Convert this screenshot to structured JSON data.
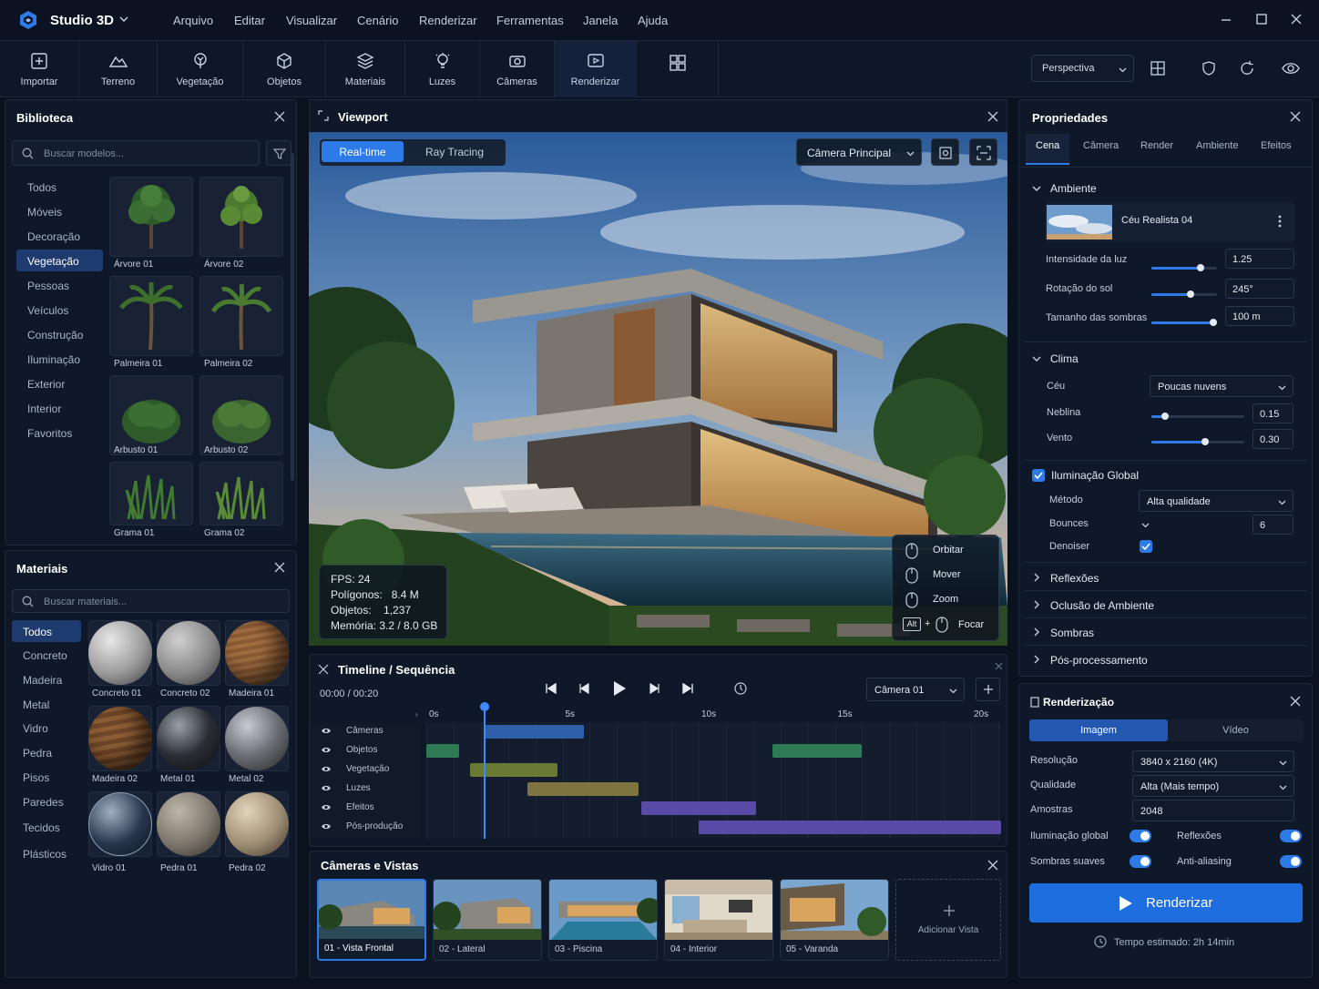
{
  "app": {
    "title": "Studio 3D"
  },
  "menu": [
    "Arquivo",
    "Editar",
    "Visualizar",
    "Cenário",
    "Renderizar",
    "Ferramentas",
    "Janela",
    "Ajuda"
  ],
  "toolbar": {
    "tools": [
      "Importar",
      "Terreno",
      "Vegetação",
      "Objetos",
      "Materiais",
      "Luzes",
      "Câmeras",
      "Renderizar"
    ],
    "view_mode": "Perspectiva"
  },
  "library": {
    "title": "Biblioteca",
    "search_placeholder": "Buscar modelos...",
    "categories": [
      "Todos",
      "Móveis",
      "Decoração",
      "Vegetação",
      "Pessoas",
      "Veículos",
      "Construção",
      "Iluminação",
      "Exterior",
      "Interior",
      "Favoritos"
    ],
    "active_category": "Vegetação",
    "items": [
      "Árvore 01",
      "Árvore 02",
      "Palmeira 01",
      "Palmeira 02",
      "Arbusto 01",
      "Arbusto 02",
      "Grama 01",
      "Grama 02"
    ]
  },
  "materials": {
    "title": "Materiais",
    "search_placeholder": "Buscar materiais...",
    "categories": [
      "Todos",
      "Concreto",
      "Madeira",
      "Metal",
      "Vidro",
      "Pedra",
      "Pisos",
      "Paredes",
      "Tecidos",
      "Plásticos"
    ],
    "active_category": "Todos",
    "items": [
      "Concreto 01",
      "Concreto 02",
      "Madeira 01",
      "Madeira 02",
      "Metal 01",
      "Metal 02",
      "Vidro 01",
      "Pedra 01",
      "Pedra 02"
    ]
  },
  "viewport": {
    "title": "Viewport",
    "modes": [
      "Real-time",
      "Ray Tracing"
    ],
    "active_mode": "Real-time",
    "camera": "Câmera Principal",
    "stats": [
      {
        "label": "FPS:",
        "value": "24"
      },
      {
        "label": "Polígonos:",
        "value": "8.4 M"
      },
      {
        "label": "Objetos:",
        "value": "1,237"
      },
      {
        "label": "Memória:",
        "value": "3.2 / 8.0 GB"
      }
    ],
    "controls": [
      "Orbitar",
      "Mover",
      "Zoom",
      "Focar"
    ],
    "alt_key": "Alt"
  },
  "timeline": {
    "title": "Timeline / Sequência",
    "time": "00:00 / 00:20",
    "camera": "Câmera 01",
    "ticks": [
      "0s",
      "5s",
      "10s",
      "15s",
      "20s"
    ],
    "tracks": [
      "Câmeras",
      "Objetos",
      "Vegetação",
      "Luzes",
      "Efeitos",
      "Pós-produção"
    ],
    "playhead_s": 2.1,
    "clips": [
      {
        "track": 0,
        "start": 2.1,
        "end": 5.8,
        "color": "#2f5fa8"
      },
      {
        "track": 1,
        "start": 0.0,
        "end": 1.2,
        "color": "#2e7a55"
      },
      {
        "track": 1,
        "start": 12.7,
        "end": 16.0,
        "color": "#2e7a55"
      },
      {
        "track": 2,
        "start": 1.6,
        "end": 4.8,
        "color": "#6a7a34"
      },
      {
        "track": 3,
        "start": 3.7,
        "end": 7.8,
        "color": "#7e7440"
      },
      {
        "track": 4,
        "start": 7.9,
        "end": 12.1,
        "color": "#5a4aa8"
      },
      {
        "track": 5,
        "start": 10.0,
        "end": 21.1,
        "color": "#5a4aa8"
      }
    ]
  },
  "cameras": {
    "title": "Câmeras e Vistas",
    "items": [
      "01 - Vista Frontal",
      "02 - Lateral",
      "03 - Piscina",
      "04 - Interior",
      "05 - Varanda"
    ],
    "add_label": "Adicionar Vista"
  },
  "properties": {
    "title": "Propriedades",
    "tabs": [
      "Cena",
      "Câmera",
      "Render",
      "Ambiente",
      "Efeitos"
    ],
    "active_tab": "Cena",
    "ambiente": {
      "title": "Ambiente",
      "sky_name": "Céu Realista 04",
      "rows": [
        {
          "label": "Intensidade da luz",
          "value": "1.25",
          "level": 0.75
        },
        {
          "label": "Rotação do sol",
          "value": "245°",
          "level": 0.6
        },
        {
          "label": "Tamanho das sombras",
          "value": "100 m",
          "level": 0.95
        }
      ]
    },
    "clima": {
      "title": "Clima",
      "sky_label": "Céu",
      "sky_value": "Poucas nuvens",
      "rows": [
        {
          "label": "Neblina",
          "value": "0.15",
          "level": 0.15
        },
        {
          "label": "Vento",
          "value": "0.30",
          "level": 0.58
        }
      ]
    },
    "gi": {
      "title": "Iluminação Global",
      "method_label": "Método",
      "method_value": "Alta qualidade",
      "bounces_label": "Bounces",
      "bounces_value": "6",
      "denoiser_label": "Denoiser"
    },
    "collapsed": [
      "Reflexões",
      "Oclusão de Ambiente",
      "Sombras",
      "Pós-processamento"
    ]
  },
  "render": {
    "title": "Renderização",
    "tabs": [
      "Imagem",
      "Vídeo"
    ],
    "active_tab": "Imagem",
    "resolution_label": "Resolução",
    "resolution_value": "3840 x 2160 (4K)",
    "quality_label": "Qualidade",
    "quality_value": "Alta (Mais tempo)",
    "samples_label": "Amostras",
    "samples_value": "2048",
    "toggles": [
      "Iluminação global",
      "Reflexões",
      "Sombras suaves",
      "Anti-aliasing"
    ],
    "button": "Renderizar",
    "estimate": "Tempo estimado: 2h 14min"
  }
}
